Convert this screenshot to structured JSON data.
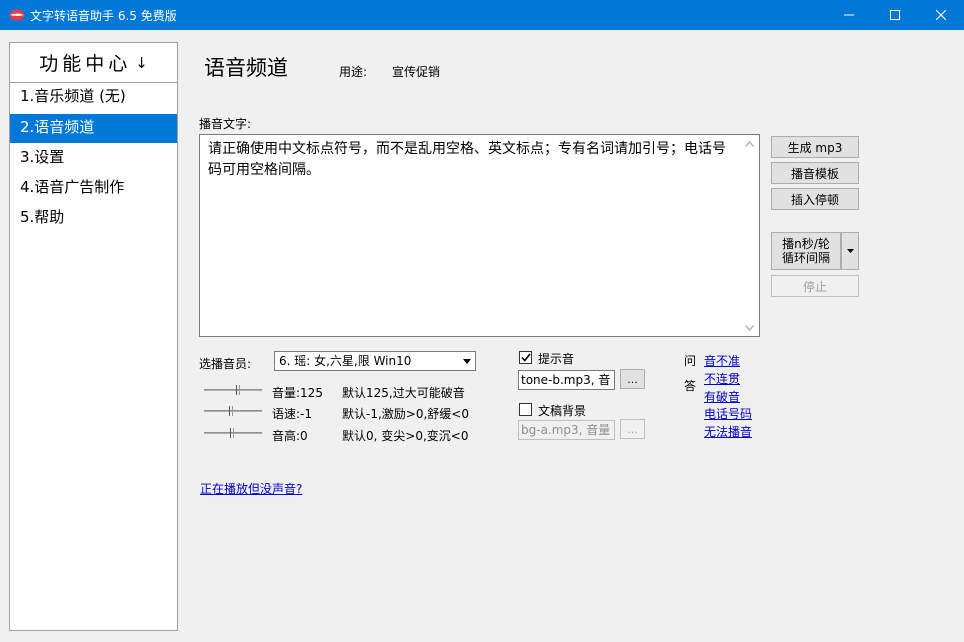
{
  "window": {
    "title": "文字转语音助手 6.5 免费版",
    "accent": "#0078d7"
  },
  "sidebar": {
    "header": "功能中心",
    "header_arrow": "↓",
    "items": [
      {
        "label": "1.音乐频道 (无)",
        "selected": false
      },
      {
        "label": "2.语音频道",
        "selected": true
      },
      {
        "label": "3.设置",
        "selected": false
      },
      {
        "label": "4.语音广告制作",
        "selected": false
      },
      {
        "label": "5.帮助",
        "selected": false
      }
    ]
  },
  "main": {
    "title": "语音频道",
    "purpose_label": "用途:",
    "purpose_value": "宣传促销",
    "text_label": "播音文字:",
    "text_value": "请正确使用中文标点符号，而不是乱用空格、英文标点；专有名词请加引号；电话号码可用空格间隔。",
    "buttons": {
      "generate": "生成 mp3",
      "template": "播音模板",
      "insert_pause": "插入停顿",
      "loop_line1": "播n秒/轮",
      "loop_line2": "循环间隔",
      "stop": "停止"
    },
    "voice": {
      "label": "选播音员:",
      "selected": "6. 瑶: 女,六星,限 Win10"
    },
    "params": [
      {
        "name": "音量:125",
        "hint": "默认125,过大可能破音",
        "level": 0.62
      },
      {
        "name": "语速:-1",
        "hint": "默认-1,激励>0,舒缓<0",
        "level": 0.48
      },
      {
        "name": "音高:0",
        "hint": "默认0, 变尖>0,变沉<0",
        "level": 0.5
      }
    ],
    "prompt_sound": {
      "label": "提示音",
      "checked": true,
      "file": "tone-b.mp3, 音",
      "browse": "..."
    },
    "bg_sound": {
      "label": "文稿背景",
      "checked": false,
      "file": "bg-a.mp3, 音量",
      "browse": "..."
    },
    "qa": {
      "label_q": "问",
      "label_a": "答",
      "links": [
        "音不准",
        "不连贯",
        "有破音",
        "电话号码",
        "无法播音"
      ]
    },
    "no_sound_link": "正在播放但没声音?"
  }
}
